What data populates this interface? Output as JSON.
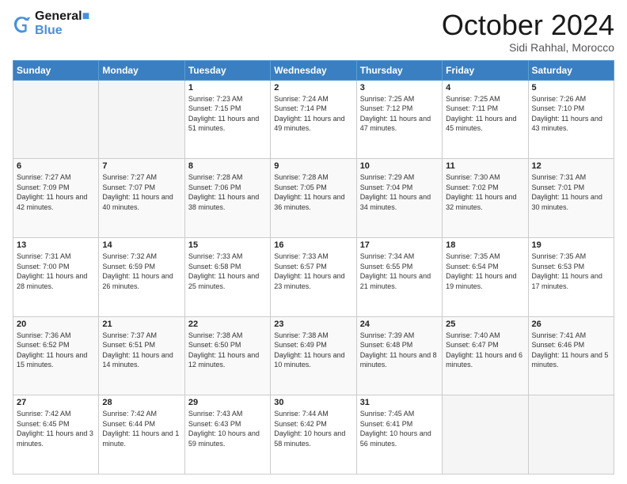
{
  "header": {
    "logo_line1": "General",
    "logo_line2": "Blue",
    "month": "October 2024",
    "location": "Sidi Rahhal, Morocco"
  },
  "weekdays": [
    "Sunday",
    "Monday",
    "Tuesday",
    "Wednesday",
    "Thursday",
    "Friday",
    "Saturday"
  ],
  "weeks": [
    [
      {
        "day": "",
        "info": ""
      },
      {
        "day": "",
        "info": ""
      },
      {
        "day": "1",
        "info": "Sunrise: 7:23 AM\nSunset: 7:15 PM\nDaylight: 11 hours and 51 minutes."
      },
      {
        "day": "2",
        "info": "Sunrise: 7:24 AM\nSunset: 7:14 PM\nDaylight: 11 hours and 49 minutes."
      },
      {
        "day": "3",
        "info": "Sunrise: 7:25 AM\nSunset: 7:12 PM\nDaylight: 11 hours and 47 minutes."
      },
      {
        "day": "4",
        "info": "Sunrise: 7:25 AM\nSunset: 7:11 PM\nDaylight: 11 hours and 45 minutes."
      },
      {
        "day": "5",
        "info": "Sunrise: 7:26 AM\nSunset: 7:10 PM\nDaylight: 11 hours and 43 minutes."
      }
    ],
    [
      {
        "day": "6",
        "info": "Sunrise: 7:27 AM\nSunset: 7:09 PM\nDaylight: 11 hours and 42 minutes."
      },
      {
        "day": "7",
        "info": "Sunrise: 7:27 AM\nSunset: 7:07 PM\nDaylight: 11 hours and 40 minutes."
      },
      {
        "day": "8",
        "info": "Sunrise: 7:28 AM\nSunset: 7:06 PM\nDaylight: 11 hours and 38 minutes."
      },
      {
        "day": "9",
        "info": "Sunrise: 7:28 AM\nSunset: 7:05 PM\nDaylight: 11 hours and 36 minutes."
      },
      {
        "day": "10",
        "info": "Sunrise: 7:29 AM\nSunset: 7:04 PM\nDaylight: 11 hours and 34 minutes."
      },
      {
        "day": "11",
        "info": "Sunrise: 7:30 AM\nSunset: 7:02 PM\nDaylight: 11 hours and 32 minutes."
      },
      {
        "day": "12",
        "info": "Sunrise: 7:31 AM\nSunset: 7:01 PM\nDaylight: 11 hours and 30 minutes."
      }
    ],
    [
      {
        "day": "13",
        "info": "Sunrise: 7:31 AM\nSunset: 7:00 PM\nDaylight: 11 hours and 28 minutes."
      },
      {
        "day": "14",
        "info": "Sunrise: 7:32 AM\nSunset: 6:59 PM\nDaylight: 11 hours and 26 minutes."
      },
      {
        "day": "15",
        "info": "Sunrise: 7:33 AM\nSunset: 6:58 PM\nDaylight: 11 hours and 25 minutes."
      },
      {
        "day": "16",
        "info": "Sunrise: 7:33 AM\nSunset: 6:57 PM\nDaylight: 11 hours and 23 minutes."
      },
      {
        "day": "17",
        "info": "Sunrise: 7:34 AM\nSunset: 6:55 PM\nDaylight: 11 hours and 21 minutes."
      },
      {
        "day": "18",
        "info": "Sunrise: 7:35 AM\nSunset: 6:54 PM\nDaylight: 11 hours and 19 minutes."
      },
      {
        "day": "19",
        "info": "Sunrise: 7:35 AM\nSunset: 6:53 PM\nDaylight: 11 hours and 17 minutes."
      }
    ],
    [
      {
        "day": "20",
        "info": "Sunrise: 7:36 AM\nSunset: 6:52 PM\nDaylight: 11 hours and 15 minutes."
      },
      {
        "day": "21",
        "info": "Sunrise: 7:37 AM\nSunset: 6:51 PM\nDaylight: 11 hours and 14 minutes."
      },
      {
        "day": "22",
        "info": "Sunrise: 7:38 AM\nSunset: 6:50 PM\nDaylight: 11 hours and 12 minutes."
      },
      {
        "day": "23",
        "info": "Sunrise: 7:38 AM\nSunset: 6:49 PM\nDaylight: 11 hours and 10 minutes."
      },
      {
        "day": "24",
        "info": "Sunrise: 7:39 AM\nSunset: 6:48 PM\nDaylight: 11 hours and 8 minutes."
      },
      {
        "day": "25",
        "info": "Sunrise: 7:40 AM\nSunset: 6:47 PM\nDaylight: 11 hours and 6 minutes."
      },
      {
        "day": "26",
        "info": "Sunrise: 7:41 AM\nSunset: 6:46 PM\nDaylight: 11 hours and 5 minutes."
      }
    ],
    [
      {
        "day": "27",
        "info": "Sunrise: 7:42 AM\nSunset: 6:45 PM\nDaylight: 11 hours and 3 minutes."
      },
      {
        "day": "28",
        "info": "Sunrise: 7:42 AM\nSunset: 6:44 PM\nDaylight: 11 hours and 1 minute."
      },
      {
        "day": "29",
        "info": "Sunrise: 7:43 AM\nSunset: 6:43 PM\nDaylight: 10 hours and 59 minutes."
      },
      {
        "day": "30",
        "info": "Sunrise: 7:44 AM\nSunset: 6:42 PM\nDaylight: 10 hours and 58 minutes."
      },
      {
        "day": "31",
        "info": "Sunrise: 7:45 AM\nSunset: 6:41 PM\nDaylight: 10 hours and 56 minutes."
      },
      {
        "day": "",
        "info": ""
      },
      {
        "day": "",
        "info": ""
      }
    ]
  ]
}
